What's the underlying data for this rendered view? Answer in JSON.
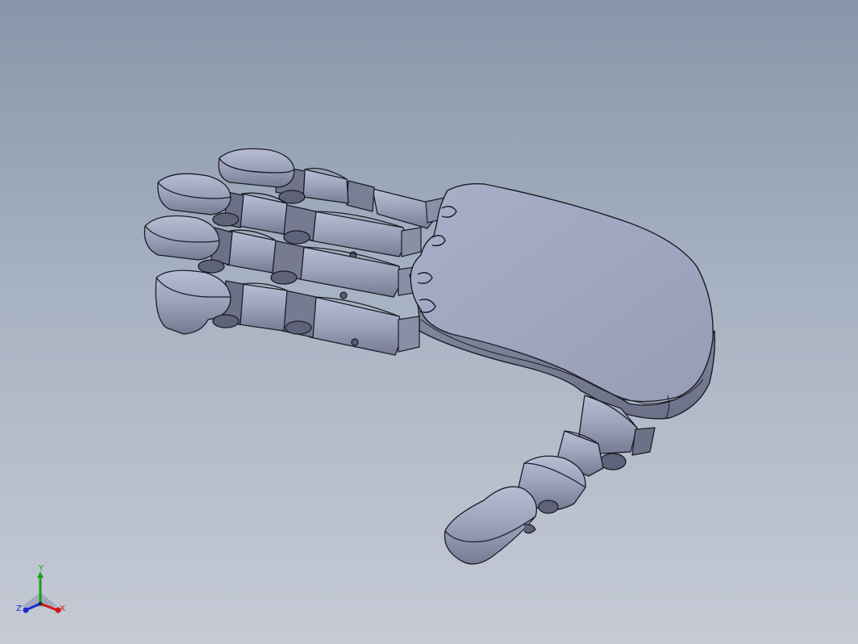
{
  "viewport": {
    "background_top": "#8796a9",
    "background_bottom": "#c6cbd5",
    "model_color": "#9da3bd",
    "model": "robotic-hand-assembly"
  },
  "triad": {
    "x_label": "X",
    "y_label": "Y",
    "z_label": "Z",
    "x_color": "#d01818",
    "y_color": "#1aa01a",
    "z_color": "#1a2ad0"
  }
}
